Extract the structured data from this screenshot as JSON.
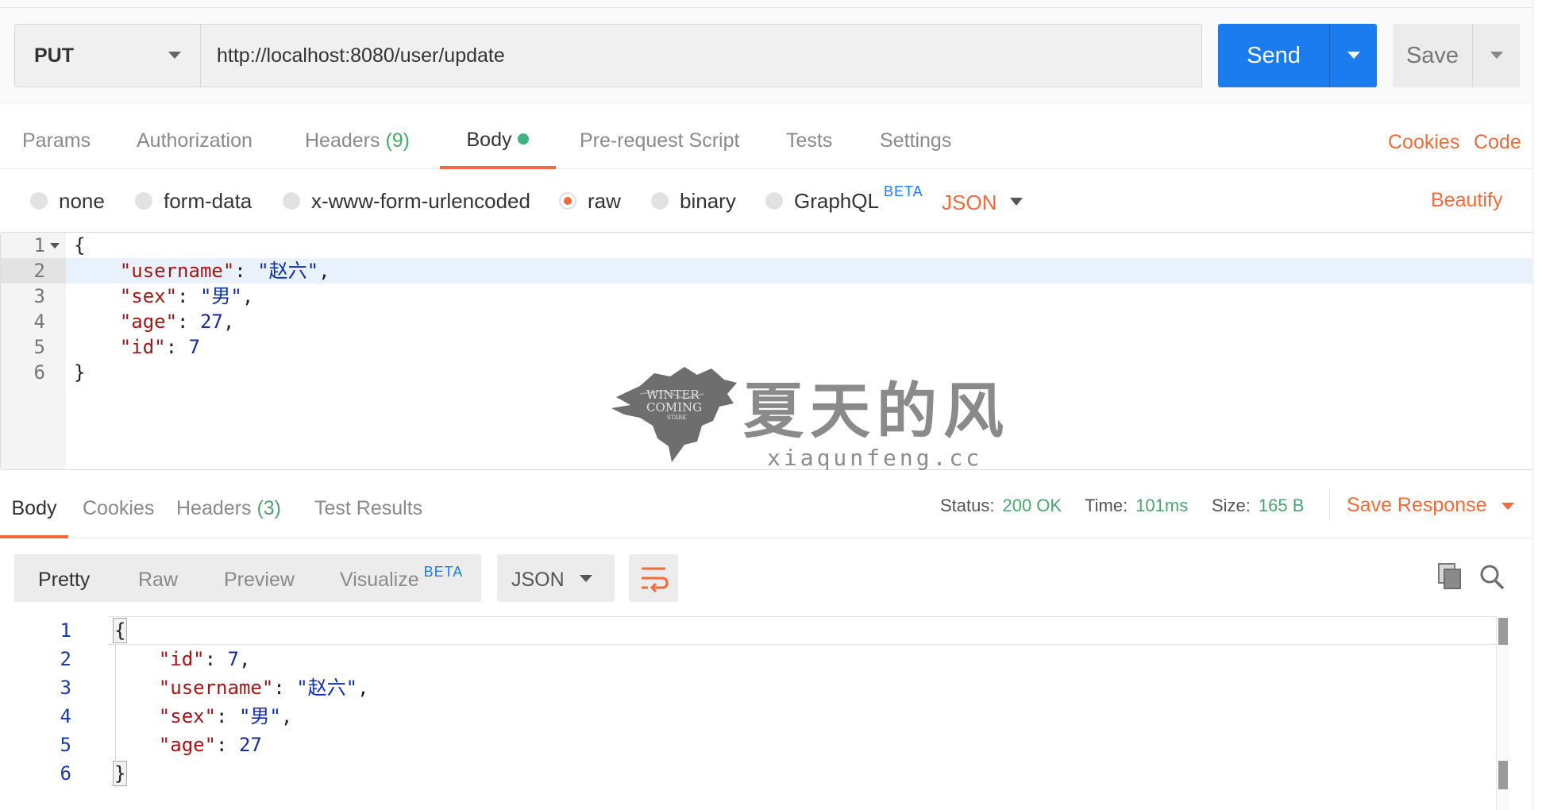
{
  "request": {
    "method": "PUT",
    "url": "http://localhost:8080/user/update",
    "send_label": "Send",
    "save_label": "Save"
  },
  "req_tabs": {
    "params": "Params",
    "authorization": "Authorization",
    "headers": "Headers",
    "headers_count": "(9)",
    "body": "Body",
    "prerequest": "Pre-request Script",
    "tests": "Tests",
    "settings": "Settings",
    "cookies": "Cookies",
    "code": "Code"
  },
  "body_types": {
    "none": "none",
    "form_data": "form-data",
    "urlencoded": "x-www-form-urlencoded",
    "raw": "raw",
    "binary": "binary",
    "graphql": "GraphQL",
    "beta": "BETA",
    "format": "JSON",
    "beautify": "Beautify",
    "selected": "raw"
  },
  "request_body": {
    "line_numbers": [
      "1",
      "2",
      "3",
      "4",
      "5",
      "6"
    ],
    "open": "{",
    "close": "}",
    "fields": [
      {
        "key": "\"username\"",
        "value": "\"赵六\"",
        "suffix": ","
      },
      {
        "key": "\"sex\"",
        "value": "\"男\"",
        "suffix": ","
      },
      {
        "key": "\"age\"",
        "value": "27",
        "suffix": ","
      },
      {
        "key": "\"id\"",
        "value": "7",
        "suffix": ""
      }
    ],
    "highlighted_line": 2
  },
  "watermark": {
    "title": "夏天的风",
    "subtitle": "xiaqunfeng.cc",
    "logo_text_1": "WINTER",
    "logo_text_2": "COMING",
    "logo_text_3": "STARK"
  },
  "response": {
    "tabs": {
      "body": "Body",
      "cookies": "Cookies",
      "headers": "Headers",
      "headers_count": "(3)",
      "test_results": "Test Results"
    },
    "status_label": "Status:",
    "status_value": "200 OK",
    "time_label": "Time:",
    "time_value": "101ms",
    "size_label": "Size:",
    "size_value": "165 B",
    "save_response": "Save Response",
    "views": {
      "pretty": "Pretty",
      "raw": "Raw",
      "preview": "Preview",
      "visualize": "Visualize",
      "beta": "BETA"
    },
    "format": "JSON",
    "line_numbers": [
      "1",
      "2",
      "3",
      "4",
      "5",
      "6"
    ],
    "open": "{",
    "close": "}",
    "fields": [
      {
        "key": "\"id\"",
        "value": "7",
        "suffix": ","
      },
      {
        "key": "\"username\"",
        "value": "\"赵六\"",
        "suffix": ","
      },
      {
        "key": "\"sex\"",
        "value": "\"男\"",
        "suffix": ","
      },
      {
        "key": "\"age\"",
        "value": "27",
        "suffix": ""
      }
    ]
  },
  "colors": {
    "accent": "#f26b3a",
    "send_blue": "#1b7cf0",
    "success_green": "#4aa66d"
  }
}
